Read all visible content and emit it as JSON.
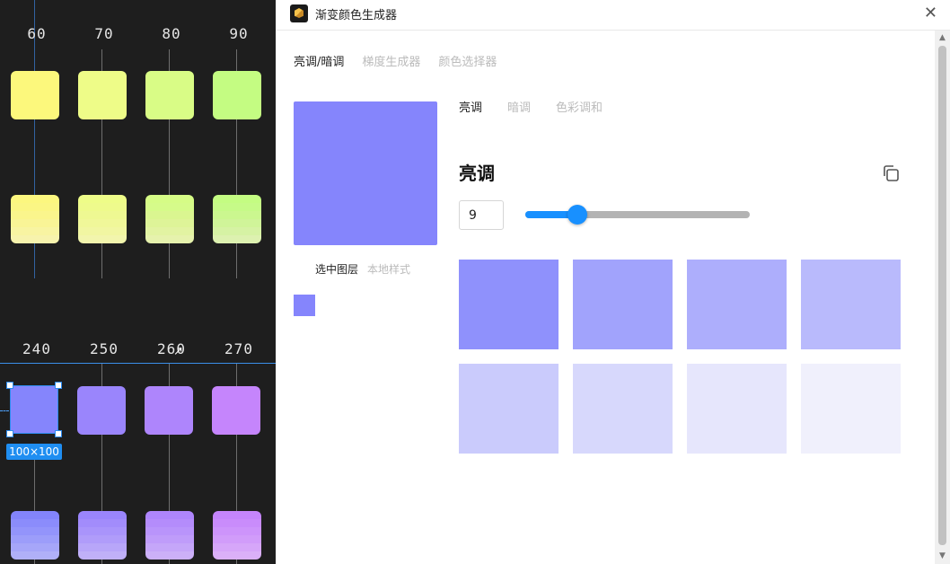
{
  "canvas": {
    "top_numbers": [
      "60",
      "70",
      "80",
      "90"
    ],
    "bottom_numbers": [
      "240",
      "250",
      "260",
      "270"
    ],
    "top_swatch_colors": [
      "#fcf87c",
      "#eefc88",
      "#d9fc86",
      "#c4fc82"
    ],
    "top_gradients": [
      [
        "#fcf77f",
        "#fbf684",
        "#faf58c",
        "#f9f496",
        "#f8f4a2",
        "#f7f3ad"
      ],
      [
        "#eefc88",
        "#eefa8c",
        "#eef892",
        "#f0f799",
        "#f1f6a2",
        "#f2f5ad"
      ],
      [
        "#d6fc86",
        "#d6fb8a",
        "#daf690",
        "#def498",
        "#e2f3a2",
        "#e6f2ad"
      ],
      [
        "#c4fc82",
        "#c6fa88",
        "#cbf78f",
        "#d0f499",
        "#d6f2a4",
        "#ddf1b0"
      ]
    ],
    "bottom_swatch_colors": [
      "#8585fc",
      "#9a85fc",
      "#ae85fc",
      "#c585fc"
    ],
    "bottom_gradients": [
      [
        "#8384fb",
        "#8b8cfb",
        "#9394fb",
        "#9c9dfa",
        "#a6a6f9",
        "#b0b0f8"
      ],
      [
        "#9a85fc",
        "#a28cfb",
        "#a994fb",
        "#b09cfa",
        "#b8a6f9",
        "#c0b0f8"
      ],
      [
        "#ae85fc",
        "#b48cfb",
        "#b994fb",
        "#bf9cfa",
        "#c5a6f9",
        "#ccb0f8"
      ],
      [
        "#c585fc",
        "#c98cfb",
        "#cd94fb",
        "#d19cfa",
        "#d6a6f9",
        "#dbb0f8"
      ]
    ],
    "selection_size": "100×100",
    "cursor_glyph": "↗"
  },
  "panel": {
    "title": "渐变颜色生成器",
    "close_glyph": "✕",
    "top_tabs": [
      {
        "label": "亮调/暗调",
        "active": true
      },
      {
        "label": "梯度生成器",
        "active": false
      },
      {
        "label": "颜色选择器",
        "active": false
      }
    ],
    "preview_color": "#8585fc",
    "source_tabs": [
      {
        "label": "选中图层",
        "active": true
      },
      {
        "label": "本地样式",
        "active": false
      }
    ],
    "mini_swatch_color": "#8585fc",
    "sub_tabs": [
      {
        "label": "亮调",
        "active": true
      },
      {
        "label": "暗调",
        "active": false
      },
      {
        "label": "色彩调和",
        "active": false
      }
    ],
    "section_title": "亮调",
    "steps_value": "9",
    "slider_fraction": 0.23,
    "accent_color": "#1890ff",
    "palette": [
      "#8f91fc",
      "#a1a3fc",
      "#adaefc",
      "#b9bafc",
      "#cacbfc",
      "#d7d8fc",
      "#e6e6fc",
      "#f0f0fc"
    ]
  }
}
